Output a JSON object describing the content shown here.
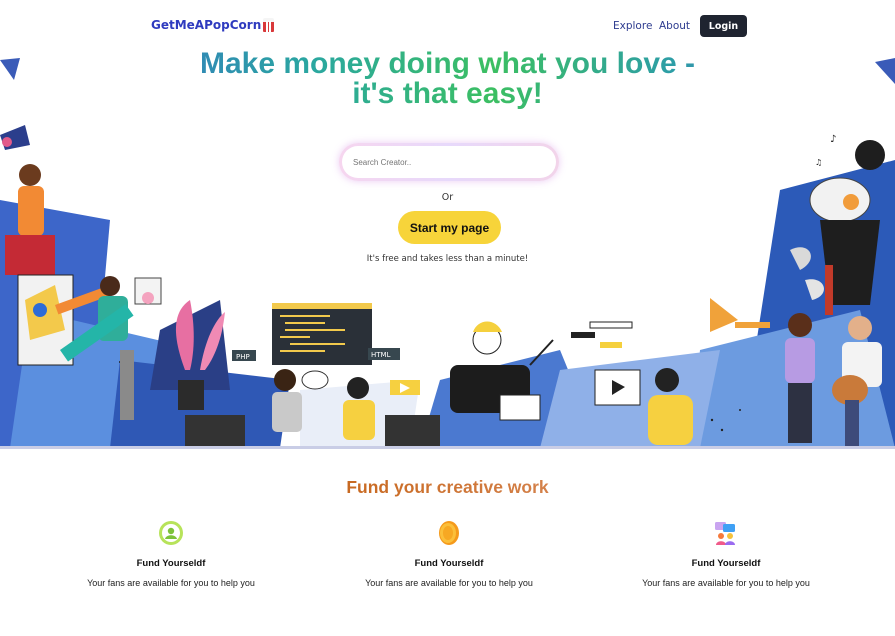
{
  "nav": {
    "brand": "GetMeAPopCorn",
    "links": [
      "Explore",
      "About"
    ],
    "login_label": "Login"
  },
  "hero": {
    "headline_line1": "Make money doing what you love -",
    "headline_line2": "it's that easy!",
    "search_placeholder": "Search Creator..",
    "or_text": "Or",
    "cta_label": "Start my page",
    "subtext": "It's free and takes less than a minute!",
    "illustration_labels": [
      "PHP",
      "HTML"
    ]
  },
  "features": {
    "title": "Fund your creative work",
    "items": [
      {
        "icon": "user-circle-icon",
        "title": "Fund Yourseldf",
        "desc": "Your fans are available for you to help you"
      },
      {
        "icon": "coin-icon",
        "title": "Fund Yourseldf",
        "desc": "Your fans are available for you to help you"
      },
      {
        "icon": "people-chat-icon",
        "title": "Fund Yourseldf",
        "desc": "Your fans are available for you to help you"
      }
    ]
  },
  "colors": {
    "login_bg": "#1f2430",
    "cta_bg": "#f7d43a",
    "brand_text": "#2f3bbf"
  }
}
